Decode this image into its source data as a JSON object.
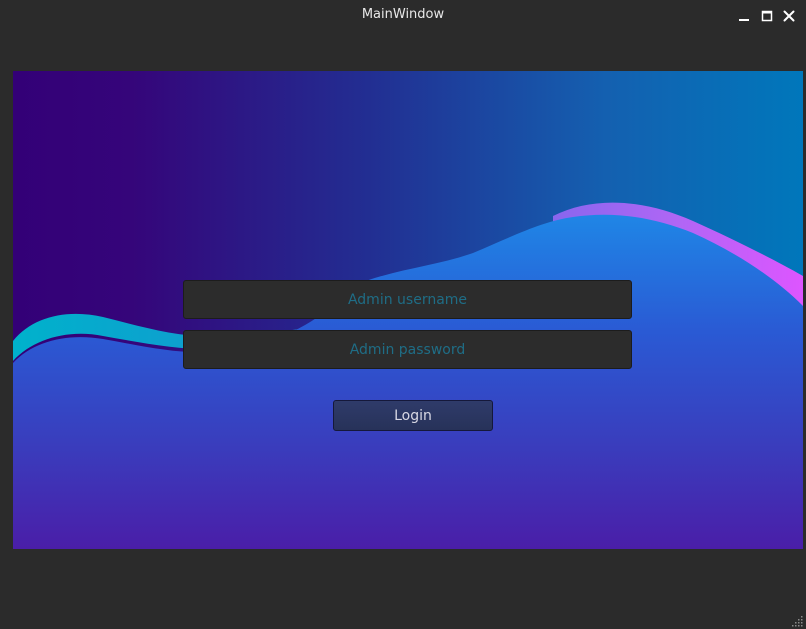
{
  "window": {
    "title": "MainWindow"
  },
  "window_controls": {
    "minimize_icon": "minimize-icon",
    "maximize_icon": "maximize-icon",
    "close_icon": "close-icon"
  },
  "login_form": {
    "username_placeholder": "Admin username",
    "password_placeholder": "Admin password",
    "username_value": "",
    "password_value": "",
    "login_label": "Login"
  },
  "colors": {
    "window_bg": "#2b2b2b",
    "gradient_top_left": "#330077",
    "gradient_top_right": "#0077bb",
    "wave_blue": "#2277dd",
    "wave_magenta": "#dd55ff",
    "wave_cyan": "#00aacc",
    "bottom_purple": "#5522aa",
    "placeholder": "#1f6d86"
  }
}
